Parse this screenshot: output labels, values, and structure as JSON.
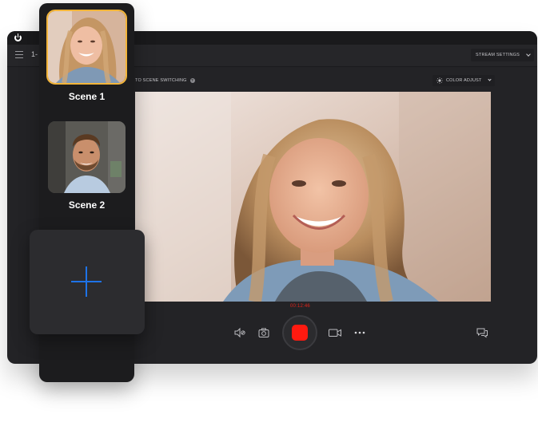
{
  "app": {
    "session_label": "1-",
    "stream_settings_label": "STREAM SETTINGS",
    "auto_scene_switching_label": "TO SCENE SWITCHING",
    "help_glyph": "?",
    "color_adjust_label": "COLOR ADJUST",
    "timer": "00:12:46"
  },
  "scenes": [
    {
      "label": "Scene 1",
      "active": true,
      "thumbnail": "woman-smiling"
    },
    {
      "label": "Scene 2",
      "active": false,
      "thumbnail": "man-smiling"
    }
  ],
  "controls": {
    "icons": [
      "mic-icon",
      "camera-snapshot-icon",
      "record-button",
      "video-camera-icon",
      "more-icon",
      "chat-icon"
    ]
  },
  "colors": {
    "record_red": "#ff1a10",
    "timer_red": "#e2231a",
    "active_scene_outline": "#f3b53a",
    "add_plus_blue": "#1e73e8",
    "app_background": "#232326",
    "panel_background": "#1c1c1e"
  }
}
